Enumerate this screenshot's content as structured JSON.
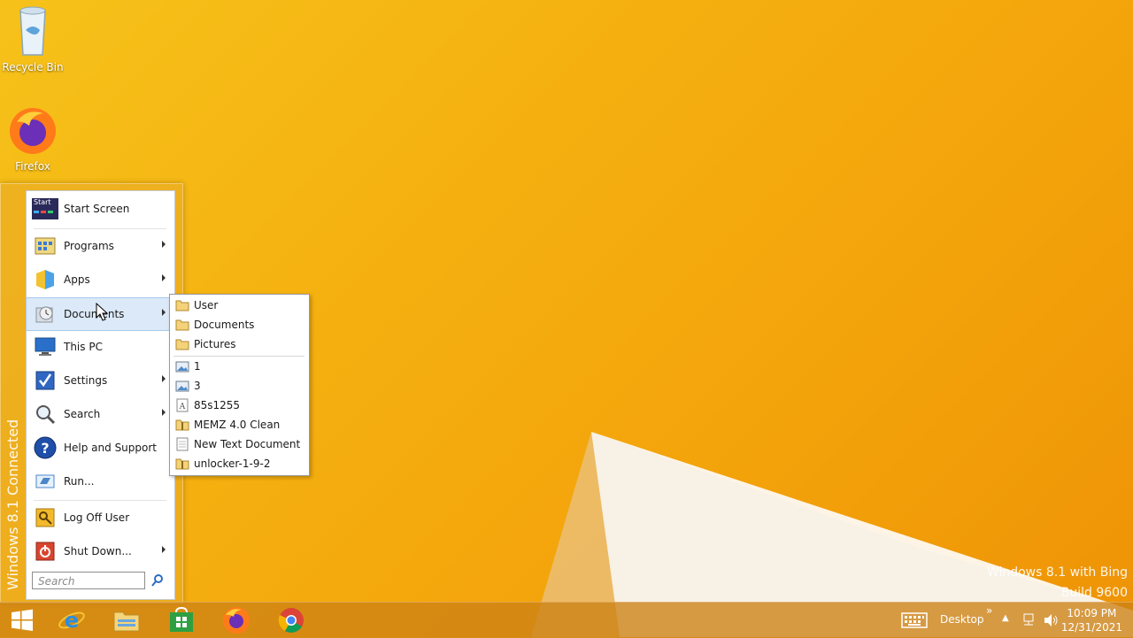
{
  "desktop": {
    "icons": [
      {
        "label": "Recycle Bin",
        "icon": "recycle-bin-icon"
      },
      {
        "label": "Firefox",
        "icon": "firefox-icon"
      }
    ],
    "watermark": {
      "line1": "Windows 8.1 with Bing",
      "line2": "Build 9600"
    }
  },
  "start_menu": {
    "side_label": "Windows 8.1 Connected",
    "items": [
      {
        "label": "Start Screen",
        "icon": "start-screen-icon",
        "has_submenu": false
      },
      {
        "label": "Programs",
        "icon": "programs-icon",
        "has_submenu": true
      },
      {
        "label": "Apps",
        "icon": "apps-icon",
        "has_submenu": true
      },
      {
        "label": "Documents",
        "icon": "documents-icon",
        "has_submenu": true,
        "highlighted": true
      },
      {
        "label": "This PC",
        "icon": "this-pc-icon",
        "has_submenu": false
      },
      {
        "label": "Settings",
        "icon": "settings-icon",
        "has_submenu": true
      },
      {
        "label": "Search",
        "icon": "search-icon",
        "has_submenu": true
      },
      {
        "label": "Help and Support",
        "icon": "help-icon",
        "has_submenu": false
      },
      {
        "label": "Run...",
        "icon": "run-icon",
        "has_submenu": false
      },
      {
        "label": "Log Off User",
        "icon": "log-off-icon",
        "has_submenu": false
      },
      {
        "label": "Shut Down...",
        "icon": "shut-down-icon",
        "has_submenu": true
      }
    ],
    "start_icon_text": "Start",
    "search_placeholder": "Search"
  },
  "documents_submenu": {
    "folders": [
      {
        "label": "User",
        "icon": "folder-icon"
      },
      {
        "label": "Documents",
        "icon": "folder-icon"
      },
      {
        "label": "Pictures",
        "icon": "folder-icon"
      }
    ],
    "recent": [
      {
        "label": "1",
        "icon": "image-file-icon"
      },
      {
        "label": "3",
        "icon": "image-file-icon"
      },
      {
        "label": "85s1255",
        "icon": "font-file-icon"
      },
      {
        "label": "MEMZ 4.0 Clean",
        "icon": "zip-folder-icon"
      },
      {
        "label": "New Text Document",
        "icon": "text-file-icon"
      },
      {
        "label": "unlocker-1-9-2",
        "icon": "zip-folder-icon"
      }
    ]
  },
  "taskbar": {
    "pinned": [
      {
        "name": "start-button",
        "icon": "windows-logo-icon"
      },
      {
        "name": "internet-explorer",
        "icon": "ie-icon"
      },
      {
        "name": "file-explorer",
        "icon": "file-explorer-icon"
      },
      {
        "name": "store",
        "icon": "store-icon"
      },
      {
        "name": "firefox",
        "icon": "firefox-icon"
      },
      {
        "name": "chrome",
        "icon": "chrome-icon"
      }
    ],
    "desktop_label": "Desktop",
    "time": "10:09 PM",
    "date": "12/31/2021"
  },
  "colors": {
    "accent_highlight": "#dbe9f8",
    "wallpaper": "#f5b110"
  }
}
